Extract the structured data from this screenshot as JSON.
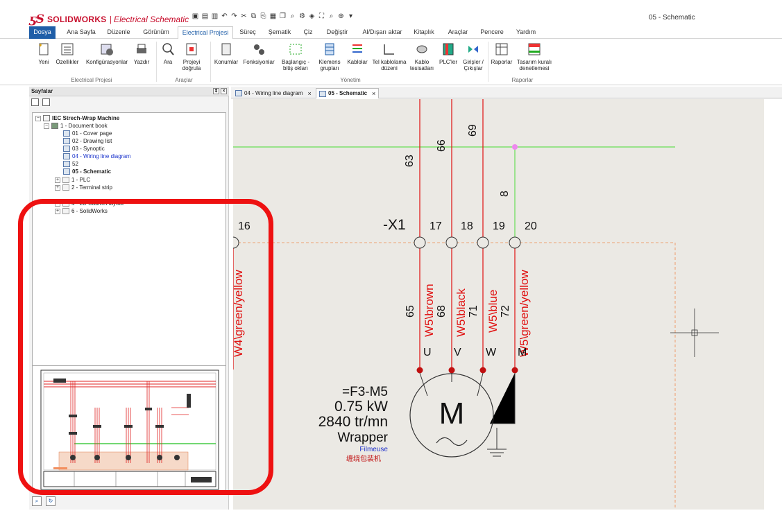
{
  "app": {
    "logo_ds": "ƽS",
    "brand": "SOLIDWORKS",
    "product": "| Electrical Schematic",
    "window_title": "05 - Schematic"
  },
  "menu_tabs": [
    "Dosya",
    "Ana Sayfa",
    "Düzenle",
    "Görünüm",
    "Electrical Projesi",
    "Süreç",
    "Şematik",
    "Çiz",
    "Değiştir",
    "Al/Dışarı aktar",
    "Kitaplık",
    "Araçlar",
    "Pencere",
    "Yardım"
  ],
  "ribbon": {
    "new": "Yeni",
    "properties": "Özellikler",
    "configurations": "Konfigürasyonlar",
    "print": "Yazdır",
    "search": "Ara",
    "verify_line1": "Projeyi",
    "verify_line2": "doğrula",
    "locations": "Konumlar",
    "functions": "Fonksiyonlar",
    "origin_line1": "Başlangıç -",
    "origin_line2": "bitiş okları",
    "terminal_line1": "Klemens",
    "terminal_line2": "grupları",
    "cables": "Kablolar",
    "wiring_line1": "Tel kablolama",
    "wiring_line2": "düzeni",
    "harness_line1": "Kablo",
    "harness_line2": "tesisatları",
    "plcs": "PLC'ler",
    "io_line1": "Girişler /",
    "io_line2": "Çıkışlar",
    "reports": "Raporlar",
    "design_rules_line1": "Tasarım kuralı",
    "design_rules_line2": "denetlemesi",
    "group_project": "Electrical Projesi",
    "group_tools": "Araçlar",
    "group_manage": "Yönetim",
    "group_reports": "Raporlar"
  },
  "panel": {
    "title": "Sayfalar",
    "tree": {
      "root": "IEC Strech-Wrap Machine",
      "book": "1 - Document book",
      "pages": [
        {
          "label": "01 - Cover page",
          "style": ""
        },
        {
          "label": "02 - Drawing list",
          "style": ""
        },
        {
          "label": "03 - Synoptic",
          "style": ""
        },
        {
          "label": "04 - Wiring line diagram",
          "style": "blue"
        },
        {
          "label": "52",
          "style": ""
        },
        {
          "label": "05 - Schematic",
          "style": "bold"
        }
      ],
      "folders": [
        "1 - PLC",
        "2 - Terminal strip",
        "4 - 2D Cabinet layout",
        "6 - SolidWorks"
      ]
    }
  },
  "doc_tabs": [
    {
      "label": "04 - Wiring line diagram",
      "active": false
    },
    {
      "label": "05 - Schematic",
      "active": true
    }
  ],
  "schematic": {
    "wire_labels_top": [
      "63",
      "66",
      "69"
    ],
    "ground_wire": "8",
    "terminal_block": "-X1",
    "terminals": [
      "16",
      "17",
      "18",
      "19",
      "20"
    ],
    "cable_labels": [
      "W4\\green/yellow",
      "W5\\brown",
      "W5\\black",
      "W5\\blue",
      "W5\\green/yellow"
    ],
    "wire_labels_bottom": [
      "65",
      "68",
      "71",
      "72"
    ],
    "motor_pins": [
      "U",
      "V",
      "W",
      "M"
    ],
    "motor_tag": "=F3-M5",
    "motor_power": "0.75 kW",
    "motor_speed": "2840 tr/mn",
    "motor_name": "Wrapper",
    "motor_name_fr": "Filmeuse",
    "motor_name_cn": "缠绕包装机",
    "motor_symbol": "M"
  },
  "colors": {
    "wire": "#e01010",
    "ground": "#66dd55",
    "junction": "#ee88ee",
    "highlight": "#ee1111",
    "file_tab": "#1f5ea8"
  }
}
